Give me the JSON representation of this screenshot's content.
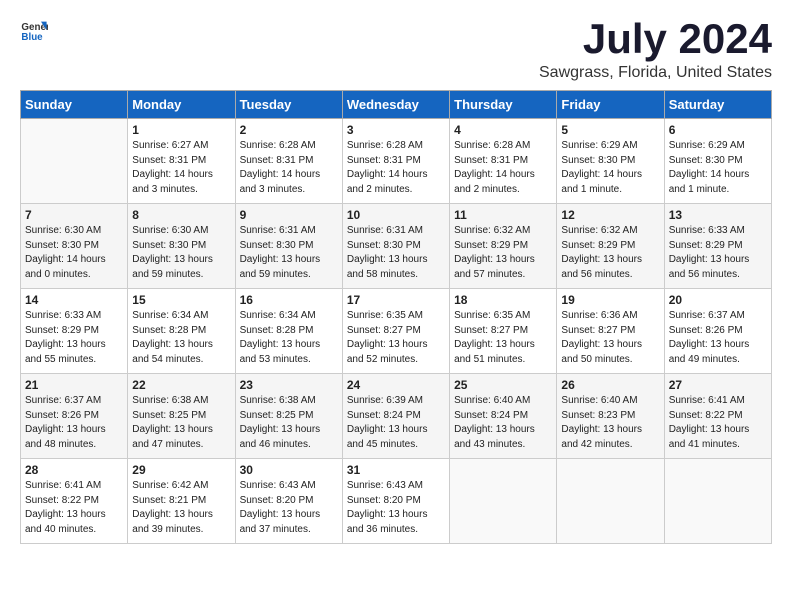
{
  "header": {
    "logo_general": "General",
    "logo_blue": "Blue",
    "month_title": "July 2024",
    "location": "Sawgrass, Florida, United States"
  },
  "days_of_week": [
    "Sunday",
    "Monday",
    "Tuesday",
    "Wednesday",
    "Thursday",
    "Friday",
    "Saturday"
  ],
  "weeks": [
    [
      {
        "day": "",
        "content": ""
      },
      {
        "day": "1",
        "content": "Sunrise: 6:27 AM\nSunset: 8:31 PM\nDaylight: 14 hours\nand 3 minutes."
      },
      {
        "day": "2",
        "content": "Sunrise: 6:28 AM\nSunset: 8:31 PM\nDaylight: 14 hours\nand 3 minutes."
      },
      {
        "day": "3",
        "content": "Sunrise: 6:28 AM\nSunset: 8:31 PM\nDaylight: 14 hours\nand 2 minutes."
      },
      {
        "day": "4",
        "content": "Sunrise: 6:28 AM\nSunset: 8:31 PM\nDaylight: 14 hours\nand 2 minutes."
      },
      {
        "day": "5",
        "content": "Sunrise: 6:29 AM\nSunset: 8:30 PM\nDaylight: 14 hours\nand 1 minute."
      },
      {
        "day": "6",
        "content": "Sunrise: 6:29 AM\nSunset: 8:30 PM\nDaylight: 14 hours\nand 1 minute."
      }
    ],
    [
      {
        "day": "7",
        "content": "Sunrise: 6:30 AM\nSunset: 8:30 PM\nDaylight: 14 hours\nand 0 minutes."
      },
      {
        "day": "8",
        "content": "Sunrise: 6:30 AM\nSunset: 8:30 PM\nDaylight: 13 hours\nand 59 minutes."
      },
      {
        "day": "9",
        "content": "Sunrise: 6:31 AM\nSunset: 8:30 PM\nDaylight: 13 hours\nand 59 minutes."
      },
      {
        "day": "10",
        "content": "Sunrise: 6:31 AM\nSunset: 8:30 PM\nDaylight: 13 hours\nand 58 minutes."
      },
      {
        "day": "11",
        "content": "Sunrise: 6:32 AM\nSunset: 8:29 PM\nDaylight: 13 hours\nand 57 minutes."
      },
      {
        "day": "12",
        "content": "Sunrise: 6:32 AM\nSunset: 8:29 PM\nDaylight: 13 hours\nand 56 minutes."
      },
      {
        "day": "13",
        "content": "Sunrise: 6:33 AM\nSunset: 8:29 PM\nDaylight: 13 hours\nand 56 minutes."
      }
    ],
    [
      {
        "day": "14",
        "content": "Sunrise: 6:33 AM\nSunset: 8:29 PM\nDaylight: 13 hours\nand 55 minutes."
      },
      {
        "day": "15",
        "content": "Sunrise: 6:34 AM\nSunset: 8:28 PM\nDaylight: 13 hours\nand 54 minutes."
      },
      {
        "day": "16",
        "content": "Sunrise: 6:34 AM\nSunset: 8:28 PM\nDaylight: 13 hours\nand 53 minutes."
      },
      {
        "day": "17",
        "content": "Sunrise: 6:35 AM\nSunset: 8:27 PM\nDaylight: 13 hours\nand 52 minutes."
      },
      {
        "day": "18",
        "content": "Sunrise: 6:35 AM\nSunset: 8:27 PM\nDaylight: 13 hours\nand 51 minutes."
      },
      {
        "day": "19",
        "content": "Sunrise: 6:36 AM\nSunset: 8:27 PM\nDaylight: 13 hours\nand 50 minutes."
      },
      {
        "day": "20",
        "content": "Sunrise: 6:37 AM\nSunset: 8:26 PM\nDaylight: 13 hours\nand 49 minutes."
      }
    ],
    [
      {
        "day": "21",
        "content": "Sunrise: 6:37 AM\nSunset: 8:26 PM\nDaylight: 13 hours\nand 48 minutes."
      },
      {
        "day": "22",
        "content": "Sunrise: 6:38 AM\nSunset: 8:25 PM\nDaylight: 13 hours\nand 47 minutes."
      },
      {
        "day": "23",
        "content": "Sunrise: 6:38 AM\nSunset: 8:25 PM\nDaylight: 13 hours\nand 46 minutes."
      },
      {
        "day": "24",
        "content": "Sunrise: 6:39 AM\nSunset: 8:24 PM\nDaylight: 13 hours\nand 45 minutes."
      },
      {
        "day": "25",
        "content": "Sunrise: 6:40 AM\nSunset: 8:24 PM\nDaylight: 13 hours\nand 43 minutes."
      },
      {
        "day": "26",
        "content": "Sunrise: 6:40 AM\nSunset: 8:23 PM\nDaylight: 13 hours\nand 42 minutes."
      },
      {
        "day": "27",
        "content": "Sunrise: 6:41 AM\nSunset: 8:22 PM\nDaylight: 13 hours\nand 41 minutes."
      }
    ],
    [
      {
        "day": "28",
        "content": "Sunrise: 6:41 AM\nSunset: 8:22 PM\nDaylight: 13 hours\nand 40 minutes."
      },
      {
        "day": "29",
        "content": "Sunrise: 6:42 AM\nSunset: 8:21 PM\nDaylight: 13 hours\nand 39 minutes."
      },
      {
        "day": "30",
        "content": "Sunrise: 6:43 AM\nSunset: 8:20 PM\nDaylight: 13 hours\nand 37 minutes."
      },
      {
        "day": "31",
        "content": "Sunrise: 6:43 AM\nSunset: 8:20 PM\nDaylight: 13 hours\nand 36 minutes."
      },
      {
        "day": "",
        "content": ""
      },
      {
        "day": "",
        "content": ""
      },
      {
        "day": "",
        "content": ""
      }
    ]
  ]
}
